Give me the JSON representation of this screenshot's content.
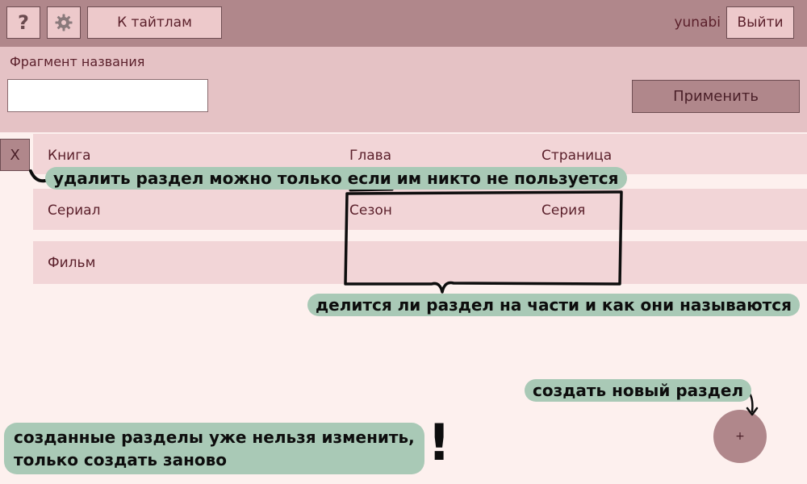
{
  "header": {
    "help_icon": "?",
    "settings_icon": "gear-icon",
    "back_button": "К тайтлам",
    "username": "yunabi",
    "logout_button": "Выйти"
  },
  "filter": {
    "label": "Фрагмент названия",
    "value": "",
    "apply_button": "Применить"
  },
  "sections": [
    {
      "name": "Книга",
      "part1": "Глава",
      "part2": "Страница"
    },
    {
      "name": "Сериал",
      "part1": "Сезон",
      "part2": "Серия"
    },
    {
      "name": "Фильм",
      "part1": "",
      "part2": ""
    }
  ],
  "delete_button": "X",
  "add_button": "+",
  "annotations": {
    "delete_note": "удалить раздел можно только если им никто не пользуется",
    "parts_note": "делится ли раздел на части и как они называются",
    "create_note": "создать новый раздел",
    "immutable_note_line1": "созданные разделы уже нельзя изменить,",
    "immutable_note_line2": "только создать заново",
    "exclamation": "!"
  },
  "colors": {
    "header_bg": "#b0878b",
    "filter_bg": "#e5c2c5",
    "row_bg": "#f2d5d7",
    "page_bg": "#fdf0ee",
    "text": "#5a1f2a",
    "annotation_bg": "#a9c9b6"
  }
}
